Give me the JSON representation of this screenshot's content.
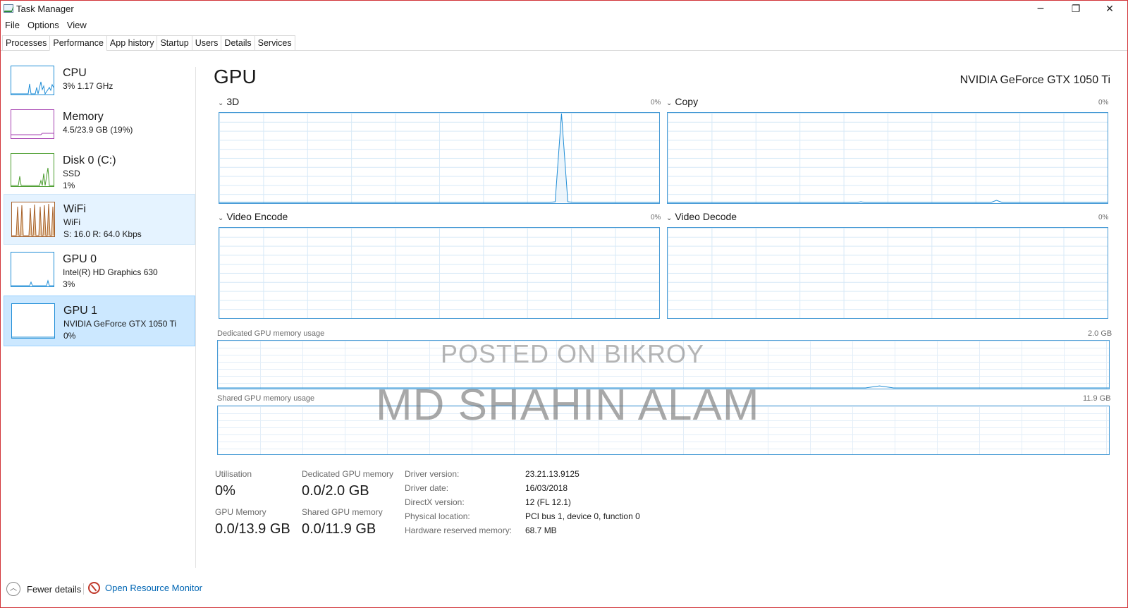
{
  "window": {
    "title": "Task Manager",
    "controls": {
      "minimize": "─",
      "maximize": "❐",
      "close": "✕"
    }
  },
  "menu": [
    "File",
    "Options",
    "View"
  ],
  "tabs": [
    "Processes",
    "Performance",
    "App history",
    "Startup",
    "Users",
    "Details",
    "Services"
  ],
  "active_tab": "Performance",
  "sidebar": [
    {
      "title": "CPU",
      "lines": [
        "3%  1.17 GHz"
      ],
      "color": "#1f8dd6"
    },
    {
      "title": "Memory",
      "lines": [
        "4.5/23.9 GB (19%)"
      ],
      "color": "#a53fb0"
    },
    {
      "title": "Disk 0 (C:)",
      "lines": [
        "SSD",
        "1%"
      ],
      "color": "#4a9c2d"
    },
    {
      "title": "WiFi",
      "lines": [
        "WiFi",
        "S: 16.0  R: 64.0 Kbps"
      ],
      "color": "#a7622b"
    },
    {
      "title": "GPU 0",
      "lines": [
        "Intel(R) HD Graphics 630",
        "3%"
      ],
      "color": "#1f8dd6"
    },
    {
      "title": "GPU 1",
      "lines": [
        "NVIDIA GeForce GTX 1050 Ti",
        "0%"
      ],
      "color": "#1f8dd6"
    }
  ],
  "main": {
    "title": "GPU",
    "device": "NVIDIA GeForce GTX 1050 Ti",
    "engines": [
      {
        "label": "3D",
        "pct": "0%"
      },
      {
        "label": "Copy",
        "pct": "0%"
      },
      {
        "label": "Video Encode",
        "pct": "0%"
      },
      {
        "label": "Video Decode",
        "pct": "0%"
      }
    ],
    "dedicated_label": "Dedicated GPU memory usage",
    "dedicated_max": "2.0 GB",
    "shared_label": "Shared GPU memory usage",
    "shared_max": "11.9 GB",
    "graph_color": "#1f8dd6"
  },
  "stats": {
    "utilisation_label": "Utilisation",
    "utilisation": "0%",
    "dedicated_label": "Dedicated GPU memory",
    "dedicated": "0.0/2.0 GB",
    "gpu_memory_label": "GPU Memory",
    "gpu_memory": "0.0/13.9 GB",
    "shared_label": "Shared GPU memory",
    "shared": "0.0/11.9 GB"
  },
  "info": [
    {
      "key": "Driver version:",
      "value": "23.21.13.9125"
    },
    {
      "key": "Driver date:",
      "value": "16/03/2018"
    },
    {
      "key": "DirectX version:",
      "value": "12 (FL 12.1)"
    },
    {
      "key": "Physical location:",
      "value": "PCI bus 1, device 0, function 0"
    },
    {
      "key": "Hardware reserved memory:",
      "value": "68.7 MB"
    }
  ],
  "watermark": {
    "line1": "POSTED ON BIKROY",
    "line2": "MD SHAHIN ALAM"
  },
  "footer": {
    "fewer_details": "Fewer details",
    "open_resource_monitor": "Open Resource Monitor"
  }
}
